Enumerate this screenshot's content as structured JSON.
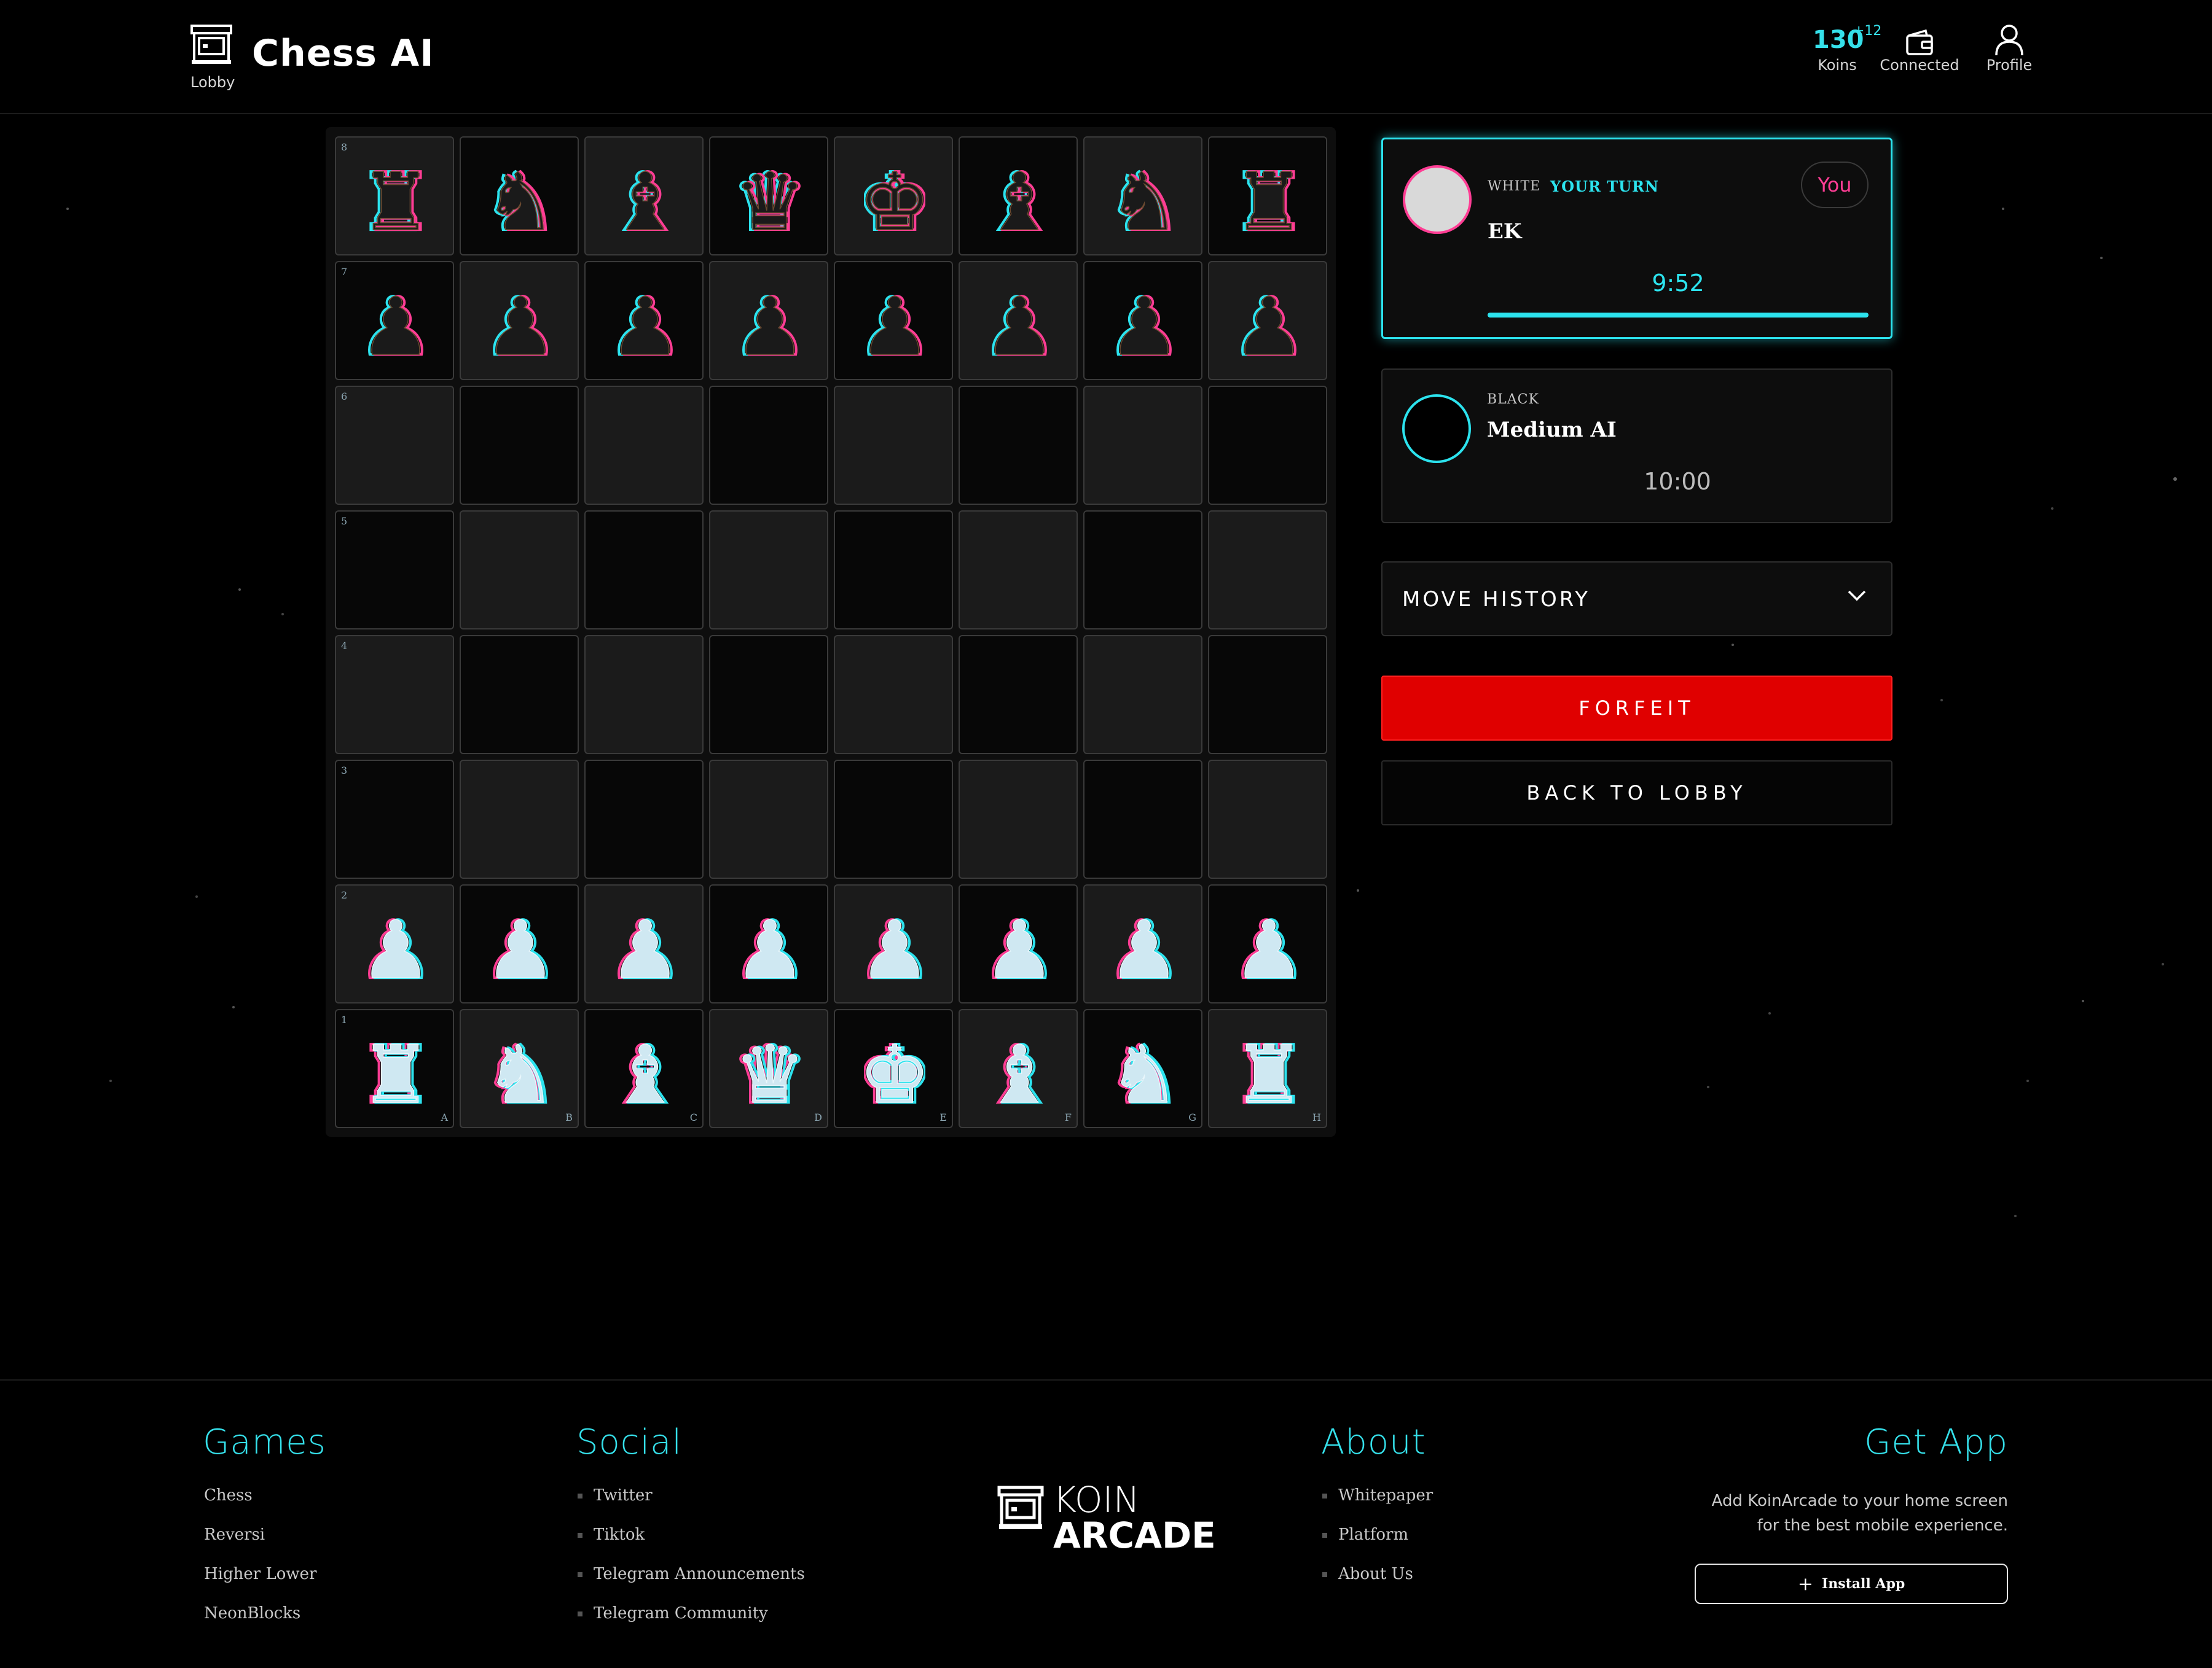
{
  "header": {
    "title": "Chess AI",
    "lobby_label": "Lobby",
    "koins_value": "130",
    "koins_delta": "+12",
    "koins_label": "Koins",
    "wallet_label": "Connected",
    "profile_label": "Profile"
  },
  "board": {
    "ranks": [
      "8",
      "7",
      "6",
      "5",
      "4",
      "3",
      "2",
      "1"
    ],
    "files": [
      "A",
      "B",
      "C",
      "D",
      "E",
      "F",
      "G",
      "H"
    ],
    "rows": [
      [
        "rook",
        "knight",
        "bishop",
        "queen",
        "king",
        "bishop",
        "knight",
        "rook"
      ],
      [
        "pawn",
        "pawn",
        "pawn",
        "pawn",
        "pawn",
        "pawn",
        "pawn",
        "pawn"
      ],
      [
        "",
        "",
        "",
        "",
        "",
        "",
        "",
        ""
      ],
      [
        "",
        "",
        "",
        "",
        "",
        "",
        "",
        ""
      ],
      [
        "",
        "",
        "",
        "",
        "",
        "",
        "",
        ""
      ],
      [
        "",
        "",
        "",
        "",
        "",
        "",
        "",
        ""
      ],
      [
        "pawn",
        "pawn",
        "pawn",
        "pawn",
        "pawn",
        "pawn",
        "pawn",
        "pawn"
      ],
      [
        "rook",
        "knight",
        "bishop",
        "queen",
        "king",
        "bishop",
        "knight",
        "rook"
      ]
    ],
    "dark_piece_color": "#1a1a1a",
    "light_piece_color": "#cfe8f2"
  },
  "players": {
    "white": {
      "side": "WHITE",
      "turn": "YOUR TURN",
      "name": "EK",
      "badge": "You",
      "clock": "9:52"
    },
    "black": {
      "side": "BLACK",
      "name": "Medium AI",
      "clock": "10:00"
    }
  },
  "panel": {
    "move_history": "MOVE HISTORY",
    "forfeit": "FORFEIT",
    "back_to_lobby": "BACK TO LOBBY"
  },
  "footer": {
    "games": {
      "title": "Games",
      "links": [
        "Chess",
        "Reversi",
        "Higher Lower",
        "NeonBlocks"
      ]
    },
    "social": {
      "title": "Social",
      "links": [
        "Twitter",
        "Tiktok",
        "Telegram Announcements",
        "Telegram Community"
      ]
    },
    "about": {
      "title": "About",
      "links": [
        "Whitepaper",
        "Platform",
        "About Us"
      ]
    },
    "get_app": {
      "title": "Get App",
      "desc_line1": "Add KoinArcade to your home screen",
      "desc_line2": "for the best mobile experience.",
      "install": "Install App"
    },
    "brand_top": "KOIN",
    "brand_bottom": "ARCADE"
  },
  "colors": {
    "accent": "#2ce3ee",
    "pink": "#ff3d94",
    "forfeit_red": "#e00000"
  }
}
